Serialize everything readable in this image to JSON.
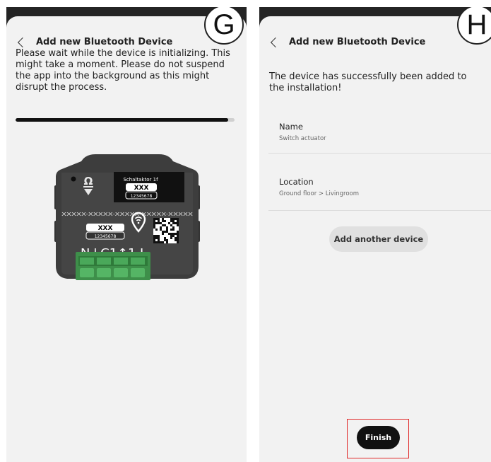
{
  "screen_g": {
    "step_letter": "G",
    "header_title": "Add new Bluetooth Device",
    "message": "Please wait while the device is initializing. This might take a moment. Please do not suspend the app into the background as this might disrupt the process.",
    "progress_fraction": 0.97,
    "device": {
      "top_label": "Schaltaktor 1f",
      "top_code": "XXX",
      "top_serial": "12345678",
      "id_string": "XXXXX-XXXXX-XXXXX-XXXXX-XXXXX",
      "side_code": "XXX",
      "side_serial": "12345678",
      "terminal_labels": "N↓C1↑1 L"
    }
  },
  "screen_h": {
    "step_letter": "H",
    "header_title": "Add new Bluetooth Device",
    "message": "The device has successfully been added to the installation!",
    "name_label": "Name",
    "name_value": "Switch actuator",
    "location_label": "Location",
    "location_value": "Ground floor > Livingroom",
    "add_another_label": "Add another device",
    "finish_label": "Finish"
  },
  "colors": {
    "background": "#f2f2f2",
    "primary_button": "#111111",
    "secondary_button": "#e0e0e0",
    "highlight": "#e02828"
  },
  "icons": [
    "chevron-left-icon",
    "wifi-location-icon",
    "qr-code-icon"
  ]
}
